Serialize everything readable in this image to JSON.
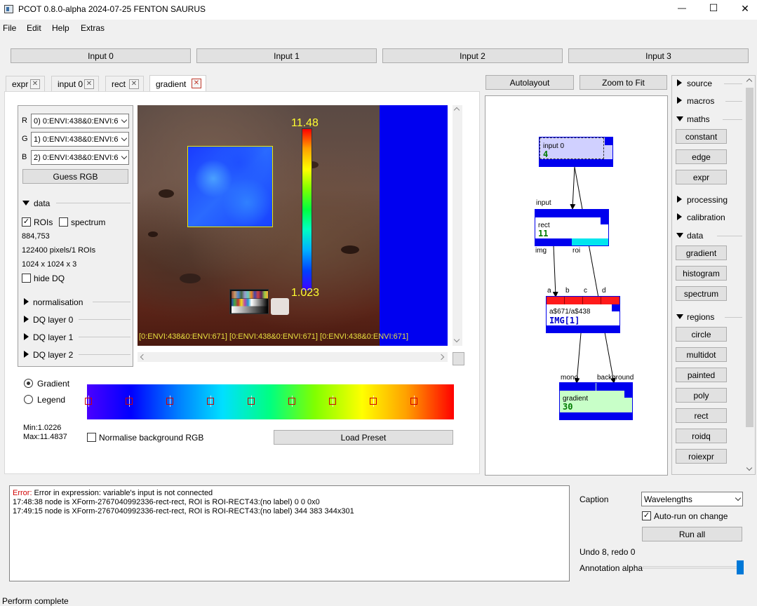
{
  "window": {
    "title": "PCOT 0.8.0-alpha 2024-07-25 FENTON SAURUS",
    "minimize": "—",
    "maximize": "☐",
    "close": "✕"
  },
  "menu": [
    "File",
    "Edit",
    "Help",
    "Extras"
  ],
  "inputs": [
    "Input 0",
    "Input 1",
    "Input 2",
    "Input 3"
  ],
  "tabs": [
    "expr",
    "input 0",
    "rect",
    "gradient"
  ],
  "tab_close": "✕",
  "canvas": {
    "rgb_labels": [
      "R",
      "G",
      "B"
    ],
    "rgb_values": [
      "0) 0:ENVI:438&0:ENVI:6",
      "1) 0:ENVI:438&0:ENVI:6",
      "2) 0:ENVI:438&0:ENVI:6"
    ],
    "guess_rgb": "Guess RGB",
    "data_label": "data",
    "rois_label": "ROIs",
    "rois_checked": "✓",
    "spectrum_label": "spectrum",
    "coords": "884,753",
    "pixels": "122400 pixels/1 ROIs",
    "dims": "1024 x 1024 x 3",
    "hide_dq": "hide DQ",
    "normalisation": "normalisation",
    "dq_layers": [
      "DQ layer 0",
      "DQ layer 1",
      "DQ layer 2"
    ],
    "scale_max": "11.48",
    "scale_min": "1.023",
    "image_caption": "[0:ENVI:438&0:ENVI:671] [0:ENVI:438&0:ENVI:671] [0:ENVI:438&0:ENVI:671]"
  },
  "gradient_panel": {
    "gradient_label": "Gradient",
    "legend_label": "Legend",
    "min": "Min:1.0226",
    "max": "Max:11.4837",
    "normalise_bg": "Normalise background RGB",
    "load_preset": "Load Preset",
    "stop_count": 9
  },
  "graph": {
    "autolayout": "Autolayout",
    "zoom_to_fit": "Zoom to Fit",
    "nodes": {
      "input0": {
        "name": "input 0",
        "value": "4"
      },
      "rect": {
        "name": "rect",
        "value": "11",
        "in_label": "input",
        "out_img": "img",
        "out_roi": "roi"
      },
      "expr": {
        "expr": "a$671/a$438",
        "value": "IMG[1]",
        "inputs": [
          "a",
          "b",
          "c",
          "d"
        ]
      },
      "gradient": {
        "name": "gradient",
        "value": "30",
        "in_mono": "mono",
        "in_background": "background"
      }
    }
  },
  "palette": {
    "groups": {
      "source": "source",
      "macros": "macros",
      "maths": "maths",
      "processing": "processing",
      "calibration": "calibration",
      "data": "data",
      "regions": "regions"
    },
    "maths_items": [
      "constant",
      "edge",
      "expr"
    ],
    "data_items": [
      "gradient",
      "histogram",
      "spectrum"
    ],
    "regions_items": [
      "circle",
      "multidot",
      "painted",
      "poly",
      "rect",
      "roidq",
      "roiexpr"
    ]
  },
  "log": {
    "error_prefix": "Error:",
    "error_text": " Error in expression: variable's input is not connected",
    "lines": [
      "17:48:38 node is XForm-2767040992336-rect-rect, ROI is ROI-RECT43:(no label) 0 0 0x0",
      "17:49:15 node is XForm-2767040992336-rect-rect, ROI is ROI-RECT43:(no label) 344 383 344x301"
    ]
  },
  "controls": {
    "caption_label": "Caption",
    "caption_value": "Wavelengths",
    "autorun_label": "Auto-run on change",
    "autorun_checked": "✓",
    "run_all": "Run all",
    "undo": "Undo 8, redo 0",
    "annotation_alpha": "Annotation alpha",
    "annotation_alpha_level": 1.0
  },
  "status_bar": "Perform complete",
  "colors": {
    "node_blue": "#0000ee",
    "node_red": "#ff1a1a",
    "input_node_fill": "#d0d0ff",
    "gradient_node_fill": "#c8ffc8",
    "roi_cyan": "#00e5ee",
    "error_red": "#d00000",
    "node_value_green": "#007a00"
  }
}
